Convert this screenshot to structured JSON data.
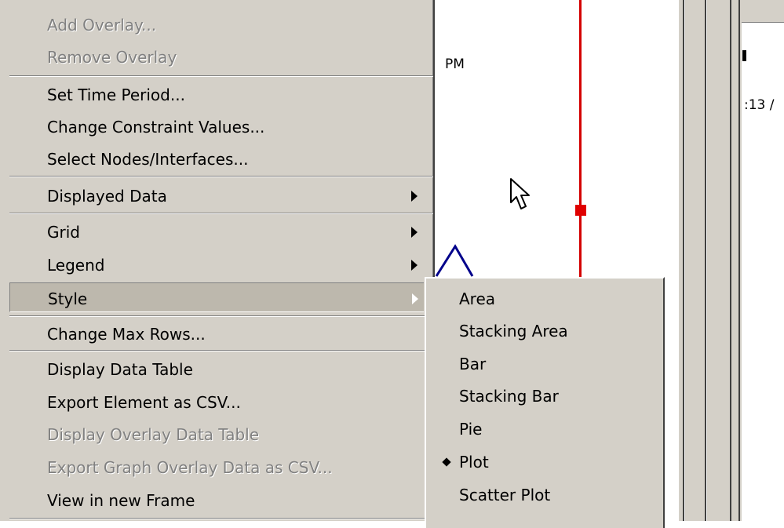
{
  "chart_background": {
    "time_label": "PM",
    "right_panel_text": ":13 /"
  },
  "context_menu": {
    "items": [
      {
        "label": "Add Overlay...",
        "enabled": false
      },
      {
        "label": "Remove Overlay",
        "enabled": false
      },
      {
        "label": "Set Time Period...",
        "enabled": true
      },
      {
        "label": "Change Constraint Values...",
        "enabled": true
      },
      {
        "label": "Select Nodes/Interfaces...",
        "enabled": true
      },
      {
        "label": "Displayed Data",
        "enabled": true,
        "submenu": true
      },
      {
        "label": "Grid",
        "enabled": true,
        "submenu": true
      },
      {
        "label": "Legend",
        "enabled": true,
        "submenu": true
      },
      {
        "label": "Style",
        "enabled": true,
        "submenu": true,
        "selected": true
      },
      {
        "label": "Change Max Rows...",
        "enabled": true
      },
      {
        "label": "Display Data Table",
        "enabled": true
      },
      {
        "label": "Export Element as CSV...",
        "enabled": true
      },
      {
        "label": "Display Overlay Data Table",
        "enabled": false
      },
      {
        "label": "Export Graph Overlay Data as CSV...",
        "enabled": false
      },
      {
        "label": "View in new Frame",
        "enabled": true
      }
    ]
  },
  "style_submenu": {
    "items": [
      {
        "label": "Area",
        "checked": false
      },
      {
        "label": "Stacking Area",
        "checked": false
      },
      {
        "label": "Bar",
        "checked": false
      },
      {
        "label": "Stacking Bar",
        "checked": false
      },
      {
        "label": "Pie",
        "checked": false
      },
      {
        "label": "Plot",
        "checked": true
      },
      {
        "label": "Scatter Plot",
        "checked": false
      }
    ]
  },
  "colors": {
    "menu_bg": "#d4d0c8",
    "disabled_text": "#808080",
    "time_marker": "#d40000",
    "series_line": "#00008b"
  }
}
